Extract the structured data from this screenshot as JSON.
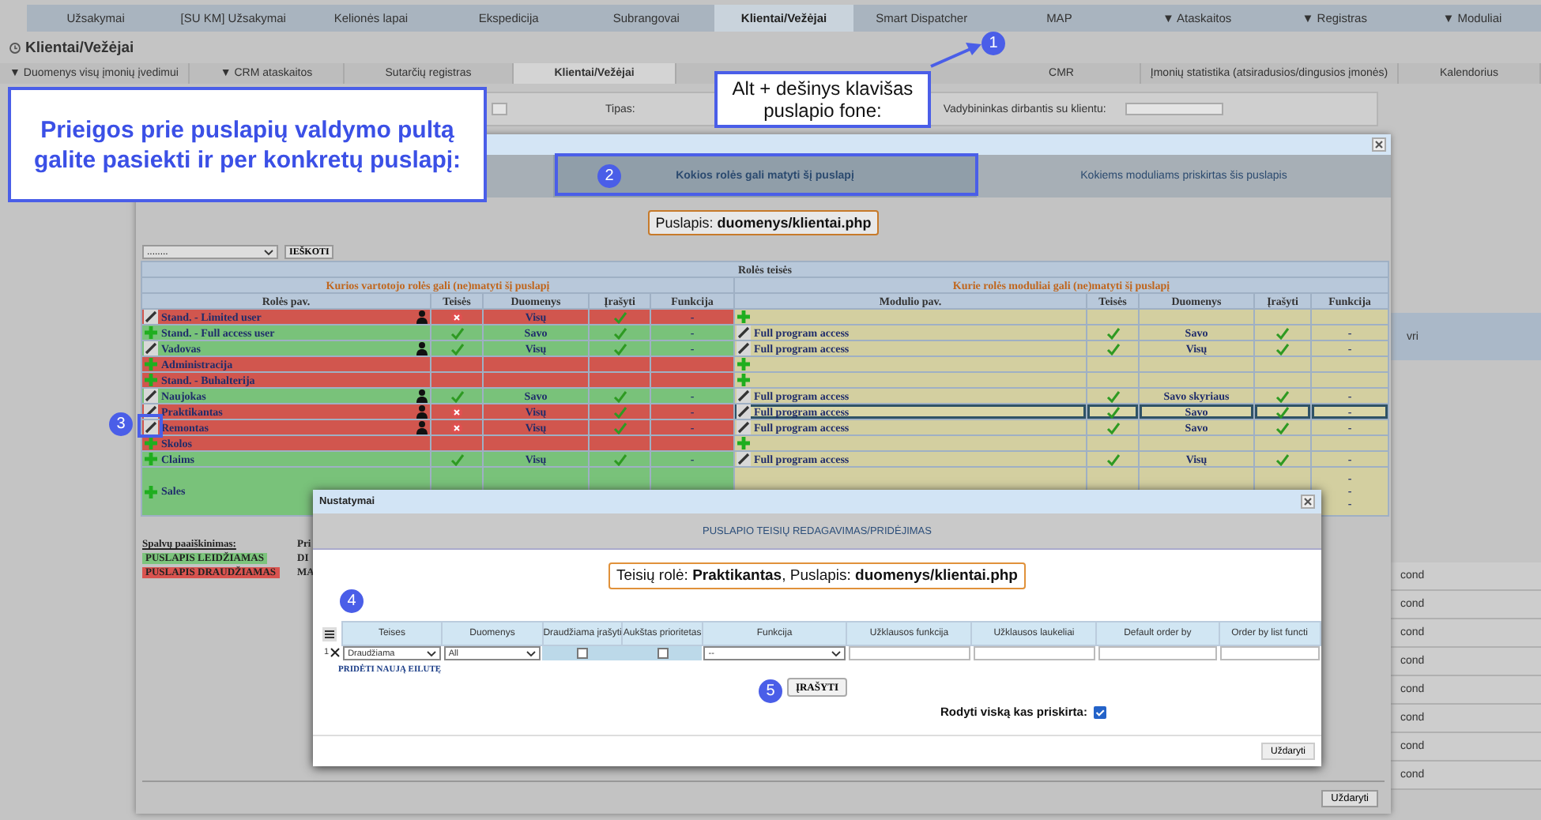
{
  "nav": {
    "items": [
      {
        "label": "Užsakymai",
        "selected": false
      },
      {
        "label": "[SU KM] Užsakymai",
        "selected": false
      },
      {
        "label": "Kelionės lapai",
        "selected": false
      },
      {
        "label": "Ekspedicija",
        "selected": false
      },
      {
        "label": "Subrangovai",
        "selected": false
      },
      {
        "label": "Klientai/Vežėjai",
        "selected": true
      },
      {
        "label": "Smart Dispatcher",
        "selected": false
      },
      {
        "label": "MAP",
        "selected": false
      },
      {
        "label": "▼ Ataskaitos",
        "selected": false
      },
      {
        "label": "▼ Registras",
        "selected": false
      },
      {
        "label": "▼ Moduliai",
        "selected": false
      }
    ]
  },
  "page_title": "Klientai/Vežėjai",
  "subnav": {
    "items": [
      {
        "label": "▼ Duomenys visų įmonių įvedimui",
        "selected": false
      },
      {
        "label": "▼ CRM ataskaitos",
        "selected": false
      },
      {
        "label": "Sutarčių registras",
        "selected": false
      },
      {
        "label": "Klientai/Vežėjai",
        "selected": true
      },
      {
        "label": "CMR",
        "selected": false
      },
      {
        "label": "Įmonių statistika (atsiradusios/dingusios įmonės)",
        "selected": false
      },
      {
        "label": "Kalendorius",
        "selected": false
      }
    ]
  },
  "filters": [
    {
      "label": "Tipas:"
    },
    {
      "label": "Vadybininkas dirbantis su klientu:"
    }
  ],
  "right_strip": {
    "items": [
      "vri",
      "cond",
      "cond",
      "cond",
      "cond",
      "cond",
      "cond",
      "cond",
      "cond"
    ]
  },
  "roles_modal": {
    "tabs": [
      {
        "label": "Kokios rolės gali matyti šį puslapį",
        "selected": true
      },
      {
        "label": "Kokiems moduliams priskirtas šis puslapis",
        "selected": false
      }
    ],
    "page_label": "Puslapis: **duomenys/klientai.php**",
    "search_select": "........",
    "search_button": "IEŠKOTI",
    "table": {
      "title": "Rolės teisės",
      "left_heading": "Kurios vartotojo rolės gali (ne)matyti šį puslapį",
      "right_heading": "Kurie rolės moduliai gali (ne)matyti šį puslapį",
      "left_columns": [
        "Rolės pav.",
        "Teisės",
        "Duomenys",
        "Įrašyti",
        "Funkcija"
      ],
      "right_columns": [
        "Modulio pav.",
        "Teisės",
        "Duomenys",
        "Įrašyti",
        "Funkcija"
      ],
      "rows": [
        {
          "selected": false,
          "role": {
            "name": "Stand. - Limited user",
            "allowed": false,
            "editable": true,
            "users": true
          },
          "rights": {
            "teises_ok": false,
            "duomenys": "Visų",
            "write": true,
            "funkcija": "-"
          },
          "module": {
            "editable": false
          }
        },
        {
          "selected": false,
          "role": {
            "name": "Stand. - Full access user",
            "allowed": true,
            "editable": false,
            "users": false
          },
          "rights": {
            "teises_ok": true,
            "duomenys": "Savo",
            "write": true,
            "funkcija": "-"
          },
          "module": {
            "editable": true,
            "name": "Full program access",
            "teises_ok": true,
            "duomenys": "Savo",
            "write": true,
            "funkcija": "-"
          }
        },
        {
          "selected": false,
          "role": {
            "name": "Vadovas",
            "allowed": true,
            "editable": true,
            "users": true
          },
          "rights": {
            "teises_ok": true,
            "duomenys": "Visų",
            "write": true,
            "funkcija": "-"
          },
          "module": {
            "editable": true,
            "name": "Full program access",
            "teises_ok": true,
            "duomenys": "Visų",
            "write": true,
            "funkcija": "-"
          }
        },
        {
          "selected": false,
          "role": {
            "name": "Administracija",
            "allowed": false,
            "editable": false,
            "users": false
          },
          "module": {
            "editable": false
          }
        },
        {
          "selected": false,
          "role": {
            "name": "Stand. - Buhalterija",
            "allowed": false,
            "editable": false,
            "users": false
          },
          "module": {
            "editable": false
          }
        },
        {
          "selected": false,
          "role": {
            "name": "Naujokas",
            "allowed": true,
            "editable": true,
            "users": true
          },
          "rights": {
            "teises_ok": true,
            "duomenys": "Savo",
            "write": true,
            "funkcija": "-"
          },
          "module": {
            "editable": true,
            "name": "Full program access",
            "teises_ok": true,
            "duomenys": "Savo skyriaus",
            "write": true,
            "funkcija": "-"
          }
        },
        {
          "selected": true,
          "role": {
            "name": "Praktikantas",
            "allowed": false,
            "editable": true,
            "users": true
          },
          "rights": {
            "teises_ok": false,
            "duomenys": "Visų",
            "write": true,
            "funkcija": "-"
          },
          "module": {
            "editable": true,
            "name": "Full program access",
            "teises_ok": true,
            "duomenys": "Savo",
            "write": true,
            "funkcija": "-"
          }
        },
        {
          "selected": false,
          "role": {
            "name": "Remontas",
            "allowed": false,
            "editable": true,
            "users": true
          },
          "rights": {
            "teises_ok": false,
            "duomenys": "Visų",
            "write": true,
            "funkcija": "-"
          },
          "module": {
            "editable": true,
            "name": "Full program access",
            "teises_ok": true,
            "duomenys": "Savo",
            "write": true,
            "funkcija": "-"
          }
        },
        {
          "selected": false,
          "role": {
            "name": "Skolos",
            "allowed": false,
            "editable": false,
            "users": false
          },
          "module": {
            "editable": false
          }
        },
        {
          "selected": false,
          "role": {
            "name": "Claims",
            "allowed": true,
            "editable": false,
            "users": false
          },
          "rights": {
            "teises_ok": true,
            "duomenys": "Visų",
            "write": true,
            "funkcija": "-"
          },
          "module": {
            "editable": true,
            "name": "Full program access",
            "teises_ok": true,
            "duomenys": "Visų",
            "write": true,
            "funkcija": "-"
          }
        },
        {
          "selected": false,
          "role": {
            "name": "Sales",
            "allowed": true,
            "editable": false,
            "users": false
          },
          "module": {
            "funkcija_lines": [
              "-",
              "-",
              "-"
            ]
          }
        }
      ]
    },
    "legend": {
      "title": "Spalvų paaiškinimas:",
      "items": [
        {
          "label": "PUSLAPIS LEIDŽIAMAS",
          "color": "#7cc47c"
        },
        {
          "label": "PUSLAPIS DRAUDŽIAMAS",
          "color": "#d9534f"
        }
      ]
    },
    "legend_cut": [
      "Pri",
      "DI",
      "MA"
    ],
    "close_button": "Uždaryti"
  },
  "settings_dialog": {
    "title": "Nustatymai",
    "heading": "PUSLAPIO TEISIŲ REDAGAVIMAS/PRIDĖJIMAS",
    "info": "Teisių rolė: **Praktikantas**, Puslapis: **duomenys/klientai.php**",
    "columns": [
      "Teises",
      "Duomenys",
      "Draudžiama įrašyti",
      "Aukštas prioritetas",
      "Funkcija",
      "Užklausos funkcija",
      "Užklausos laukeliai",
      "Default order by",
      "Order by list functi"
    ],
    "rows": [
      {
        "number": "1",
        "teises": "Draudžiama",
        "duomenys": "All",
        "no_write": false,
        "high_priority": false,
        "funkcija": "--"
      }
    ],
    "add_link": "PRIDĖTI NAUJĄ EILUTĘ",
    "save_button": "ĮRAŠYTI",
    "show_all": {
      "label": "Rodyti viską kas priskirta:",
      "checked": true
    },
    "close_button": "Uždaryti"
  },
  "callouts": [
    {
      "text": "Prieigos prie puslapių valdymo pultą galite pasiekti ir per konkretų puslapį:",
      "kind": "main"
    },
    {
      "text": "Alt + dešinys klavišas puslapio fone:",
      "kind": "note"
    }
  ],
  "badges": [
    "1",
    "2",
    "3",
    "4",
    "5"
  ]
}
